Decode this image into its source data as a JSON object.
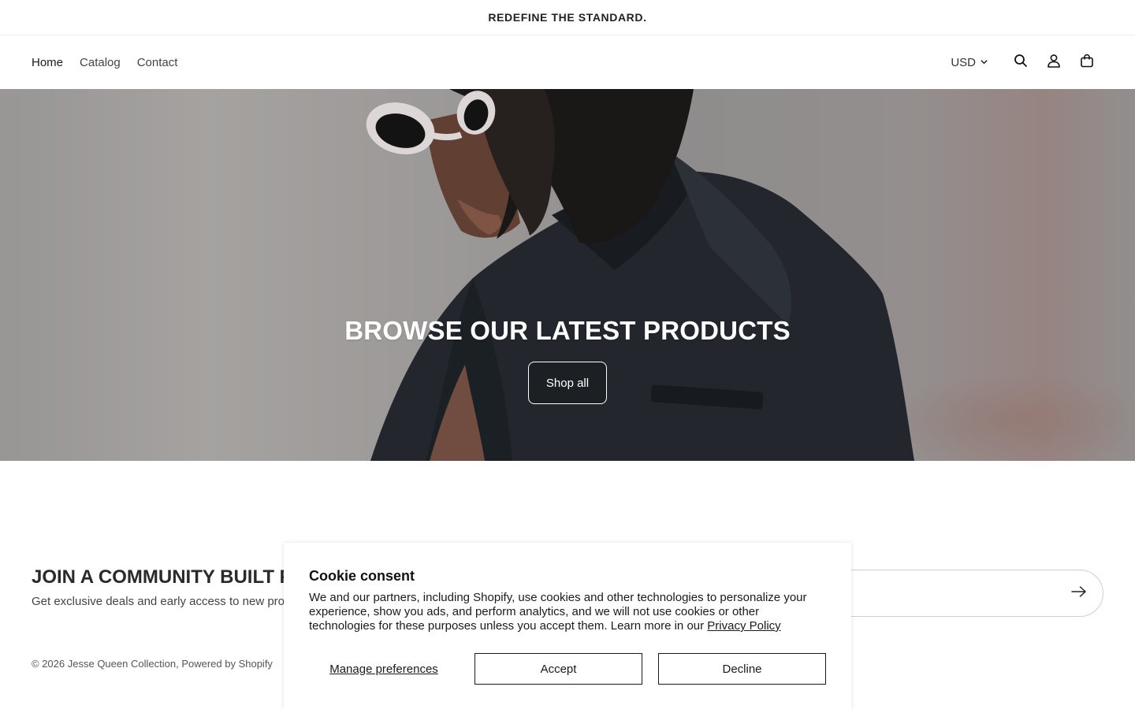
{
  "announcement": {
    "text": "REDEFINE THE STANDARD."
  },
  "nav": {
    "items": [
      {
        "label": "Home"
      },
      {
        "label": "Catalog"
      },
      {
        "label": "Contact"
      }
    ]
  },
  "header": {
    "currency": "USD",
    "icons": [
      "search-icon",
      "account-icon",
      "cart-icon"
    ]
  },
  "hero": {
    "title": "BROWSE OUR LATEST PRODUCTS",
    "button_label": "Shop all"
  },
  "newsletter": {
    "title": "JOIN A COMMUNITY BUILT FOR THE BOLD",
    "subtitle": "Get exclusive deals and early access to new products."
  },
  "footer": {
    "copyright": "© 2026",
    "store_name": "Jesse Queen Collection",
    "separator": ",",
    "powered_by": "Powered by Shopify"
  },
  "cookie_banner": {
    "title": "Cookie consent",
    "body": "We and our partners, including Shopify, use cookies and other technologies to personalize your experience, show you ads, and perform analytics, and we will not use cookies or other technologies for these purposes unless you accept them. Learn more in our",
    "privacy_link": "Privacy Policy",
    "manage_label": "Manage preferences",
    "accept_label": "Accept",
    "decline_label": "Decline"
  }
}
